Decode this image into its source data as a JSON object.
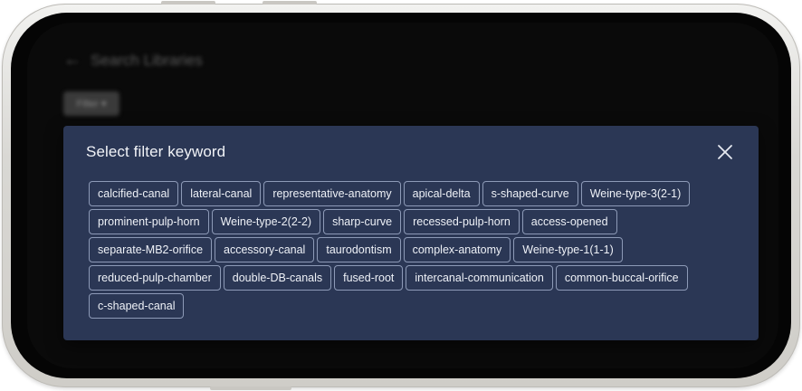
{
  "background": {
    "title": "Search Libraries",
    "filter_chip_label": "Filter ▾"
  },
  "modal": {
    "title": "Select filter keyword",
    "close_icon": "close-icon",
    "keyword_rows": [
      [
        "calcified-canal",
        "lateral-canal",
        "representative-anatomy",
        "apical-delta",
        "s-shaped-curve",
        "Weine-type-3(2-1)"
      ],
      [
        "prominent-pulp-horn",
        "Weine-type-2(2-2)",
        "sharp-curve",
        "recessed-pulp-horn",
        "access-opened"
      ],
      [
        "separate-MB2-orifice",
        "accessory-canal",
        "taurodontism",
        "complex-anatomy",
        "Weine-type-1(1-1)"
      ],
      [
        "reduced-pulp-chamber",
        "double-DB-canals",
        "fused-root",
        "intercanal-communication",
        "common-buccal-orifice"
      ],
      [
        "c-shaped-canal"
      ]
    ]
  },
  "colors": {
    "modal_bg": "#2b3755",
    "chip_border": "#8d9ab7",
    "text": "#eef1f7"
  }
}
